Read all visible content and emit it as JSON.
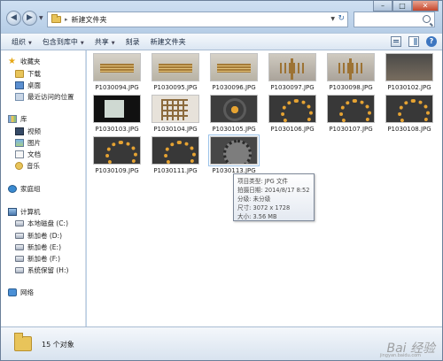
{
  "window": {
    "address_path": "新建文件夹",
    "controls": {
      "minimize": "–",
      "maximize": "□",
      "close": "✕"
    }
  },
  "toolbar": {
    "organize": "组织",
    "include_library": "包含到库中",
    "share": "共享",
    "burn": "刻录",
    "new_folder": "新建文件夹"
  },
  "nav": {
    "favorites": "收藏夹",
    "downloads": "下载",
    "desktop": "桌面",
    "recent": "最近访问的位置",
    "libraries": "库",
    "videos": "视频",
    "pictures": "图片",
    "documents": "文档",
    "music": "音乐",
    "homegroup": "家庭组",
    "computer": "计算机",
    "drive_c": "本地磁盘 (C:)",
    "drive_d": "新加卷 (D:)",
    "drive_e": "新加卷 (E:)",
    "drive_f": "新加卷 (F:)",
    "drive_h": "系统保留 (H:)",
    "network": "网络"
  },
  "files": [
    {
      "name": "P1030094.JPG",
      "look": "sticks"
    },
    {
      "name": "P1030095.JPG",
      "look": "sticks"
    },
    {
      "name": "P1030096.JPG",
      "look": "sticks"
    },
    {
      "name": "P1030097.JPG",
      "look": "vsticks"
    },
    {
      "name": "P1030098.JPG",
      "look": "vsticks"
    },
    {
      "name": "P1030102.JPG",
      "look": "photo1"
    },
    {
      "name": "P1030103.JPG",
      "look": "screen"
    },
    {
      "name": "P1030104.JPG",
      "look": "grid"
    },
    {
      "name": "P1030105.JPG",
      "look": "plate"
    },
    {
      "name": "P1030106.JPG",
      "look": "ring"
    },
    {
      "name": "P1030107.JPG",
      "look": "ring"
    },
    {
      "name": "P1030108.JPG",
      "look": "ring"
    },
    {
      "name": "P1030109.JPG",
      "look": "ring"
    },
    {
      "name": "P1030111.JPG",
      "look": "ring"
    },
    {
      "name": "P1030113.JPG",
      "look": "plate2"
    }
  ],
  "tooltip": {
    "type": "项目类型: JPG 文件",
    "date": "拍摄日期: 2014/8/17 8:52",
    "rating": "分级: 未分级",
    "dimensions": "尺寸: 3072 x 1728",
    "size": "大小: 3.56 MB"
  },
  "status": {
    "count": "15 个对象"
  },
  "watermark": {
    "text": "Bai 经验",
    "sub": "jingyan.baidu.com"
  }
}
